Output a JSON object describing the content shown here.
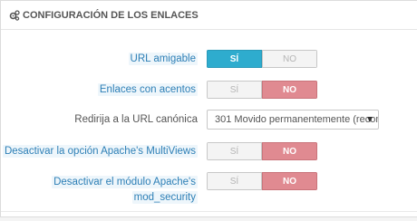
{
  "panel": {
    "title": "CONFIGURACIÓN DE LOS ENLACES",
    "icon": "gears-icon"
  },
  "settings": [
    {
      "label": "URL amigable",
      "type": "switch",
      "yes": "SÍ",
      "no": "NO",
      "selected": "yes"
    },
    {
      "label": "Enlaces con acentos",
      "type": "switch",
      "yes": "SÍ",
      "no": "NO",
      "selected": "no"
    },
    {
      "label": "Redirija a la URL canónica",
      "type": "select",
      "value": "301 Movido permanentemente (recom"
    },
    {
      "label": "Desactivar la opción Apache's MultiViews",
      "type": "switch",
      "yes": "SÍ",
      "no": "NO",
      "selected": "no"
    },
    {
      "label_line1": "Desactivar el módulo Apache's",
      "label_line2": "mod_security",
      "type": "switch",
      "yes": "SÍ",
      "no": "NO",
      "selected": "no"
    }
  ],
  "colors": {
    "active_yes": "#2eacce",
    "active_no": "#e08a91",
    "hint_text": "#2d7fb6"
  }
}
